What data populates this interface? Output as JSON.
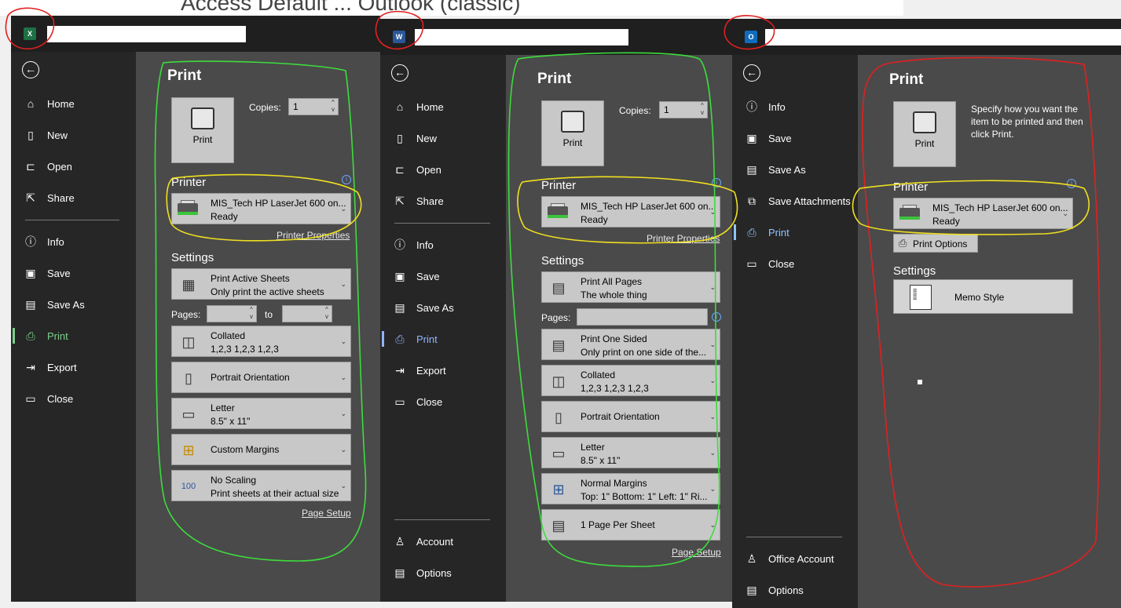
{
  "background_text": "Access Default ... Outlook (classic)",
  "colors": {
    "excel": "#1e7145",
    "word": "#2b579a",
    "outlook": "#0f6cbd",
    "green_ann": "#3ddc3d",
    "yellow_ann": "#f0e020",
    "red_ann": "#e02020"
  },
  "excel": {
    "app_icon": "X",
    "nav": {
      "home": "Home",
      "new": "New",
      "open": "Open",
      "share": "Share",
      "info": "Info",
      "save": "Save",
      "save_as": "Save As",
      "print": "Print",
      "export": "Export",
      "close": "Close"
    },
    "print_title": "Print",
    "print_button": "Print",
    "copies_label": "Copies:",
    "copies_value": "1",
    "printer_section": "Printer",
    "printer_name": "MIS_Tech HP LaserJet 600 on...",
    "printer_status": "Ready",
    "printer_properties": "Printer Properties",
    "settings_section": "Settings",
    "what_l1": "Print Active Sheets",
    "what_l2": "Only print the active sheets",
    "pages_label": "Pages:",
    "to_label": "to",
    "collated_l1": "Collated",
    "collated_l2": "1,2,3    1,2,3    1,2,3",
    "orientation": "Portrait Orientation",
    "paper_l1": "Letter",
    "paper_l2": "8.5\" x 11\"",
    "margins": "Custom Margins",
    "scaling_l1": "No Scaling",
    "scaling_l2": "Print sheets at their actual size",
    "page_setup": "Page Setup"
  },
  "word": {
    "app_icon": "W",
    "nav": {
      "home": "Home",
      "new": "New",
      "open": "Open",
      "share": "Share",
      "info": "Info",
      "save": "Save",
      "save_as": "Save As",
      "print": "Print",
      "export": "Export",
      "close": "Close",
      "account": "Account",
      "options": "Options"
    },
    "print_title": "Print",
    "print_button": "Print",
    "copies_label": "Copies:",
    "copies_value": "1",
    "printer_section": "Printer",
    "printer_name": "MIS_Tech HP LaserJet 600 on...",
    "printer_status": "Ready",
    "printer_properties": "Printer Properties",
    "settings_section": "Settings",
    "what_l1": "Print All Pages",
    "what_l2": "The whole thing",
    "pages_label": "Pages:",
    "sided_l1": "Print One Sided",
    "sided_l2": "Only print on one side of the...",
    "collated_l1": "Collated",
    "collated_l2": "1,2,3    1,2,3    1,2,3",
    "orientation": "Portrait Orientation",
    "paper_l1": "Letter",
    "paper_l2": "8.5\" x 11\"",
    "margins_l1": "Normal Margins",
    "margins_l2": "Top: 1\" Bottom: 1\" Left: 1\" Ri...",
    "per_sheet": "1 Page Per Sheet",
    "page_setup": "Page Setup"
  },
  "outlook": {
    "app_icon": "O",
    "nav": {
      "info": "Info",
      "save": "Save",
      "save_as": "Save As",
      "save_attachments": "Save Attachments",
      "print": "Print",
      "close": "Close",
      "office_account": "Office Account",
      "options": "Options"
    },
    "print_title": "Print",
    "print_button": "Print",
    "instructions": "Specify how you want the item to be printed and then click Print.",
    "printer_section": "Printer",
    "printer_name": "MIS_Tech HP LaserJet 600 on...",
    "printer_status": "Ready",
    "print_options": "Print Options",
    "settings_section": "Settings",
    "style": "Memo Style"
  }
}
